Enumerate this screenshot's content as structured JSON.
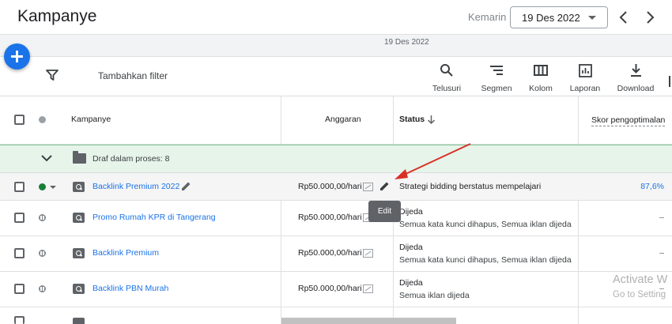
{
  "header": {
    "title": "Kampanye",
    "date_label": "Kemarin",
    "date_value": "19 Des 2022"
  },
  "subbar": {
    "date": "19 Des 2022"
  },
  "toolbar": {
    "add_filter": "Tambahkan filter",
    "tools": [
      {
        "label": "Telusuri",
        "icon": "search-icon"
      },
      {
        "label": "Segmen",
        "icon": "segment-icon"
      },
      {
        "label": "Kolom",
        "icon": "columns-icon"
      },
      {
        "label": "Laporan",
        "icon": "report-icon"
      },
      {
        "label": "Download",
        "icon": "download-icon"
      }
    ]
  },
  "table": {
    "headers": {
      "campaign": "Kampanye",
      "budget": "Anggaran",
      "status": "Status",
      "score": "Skor pengoptimalan"
    },
    "group": {
      "label": "Draf dalam proses: 8"
    },
    "rows": [
      {
        "name": "Backlink Premium 2022",
        "budget": "Rp50.000,00/hari",
        "status_line1": "Strategi bidding berstatus mempelajari",
        "status_line2": "",
        "score": "87,6%",
        "state": "enabled"
      },
      {
        "name": "Promo Rumah KPR di Tangerang",
        "budget": "Rp50.000,00/hari",
        "status_line1": "Dijeda",
        "status_line2": "Semua kata kunci dihapus, Semua iklan dijeda",
        "score": "–",
        "state": "paused"
      },
      {
        "name": "Backlink Premium",
        "budget": "Rp50.000,00/hari",
        "status_line1": "Dijeda",
        "status_line2": "Semua kata kunci dihapus, Semua iklan dijeda",
        "score": "–",
        "state": "paused"
      },
      {
        "name": "Backlink PBN Murah",
        "budget": "Rp50.000,00/hari",
        "status_line1": "Dijeda",
        "status_line2": "Semua iklan dijeda",
        "score": "–",
        "state": "paused"
      }
    ]
  },
  "tooltip": "Edit",
  "watermark": {
    "line1": "Activate W",
    "line2": "Go to Setting"
  },
  "colors": {
    "accent": "#1a73e8",
    "enabled": "#188038",
    "group_bg": "#e6f4ea",
    "annotation_arrow": "#d93025"
  }
}
